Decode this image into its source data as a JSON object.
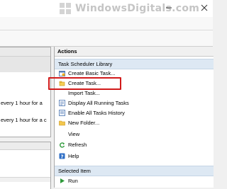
{
  "watermark": {
    "text": "WindowsDigitals.com"
  },
  "left_pane": {
    "rows": [
      {
        "text": "every 1 hour for a"
      },
      {
        "text": "every 1 hour for a c"
      }
    ]
  },
  "actions": {
    "header": "Actions",
    "sections": [
      {
        "title": "Task Scheduler Library",
        "items": [
          {
            "label": "Create Basic Task...",
            "icon": "create-basic-task-icon"
          },
          {
            "label": "Create Task...",
            "icon": "create-task-icon"
          },
          {
            "label": "Import Task...",
            "icon": "none"
          },
          {
            "label": "Display All Running Tasks",
            "icon": "running-tasks-icon"
          },
          {
            "label": "Enable All Tasks History",
            "icon": "history-icon"
          },
          {
            "label": "New Folder...",
            "icon": "folder-icon"
          },
          {
            "label": "View",
            "icon": "none"
          },
          {
            "label": "Refresh",
            "icon": "refresh-icon"
          },
          {
            "label": "Help",
            "icon": "help-icon"
          }
        ]
      },
      {
        "title": "Selected Item",
        "items": [
          {
            "label": "Run",
            "icon": "run-icon"
          }
        ]
      }
    ]
  },
  "colors": {
    "highlight": "#d11a1a",
    "section_header_bg": "#dde8f3"
  }
}
